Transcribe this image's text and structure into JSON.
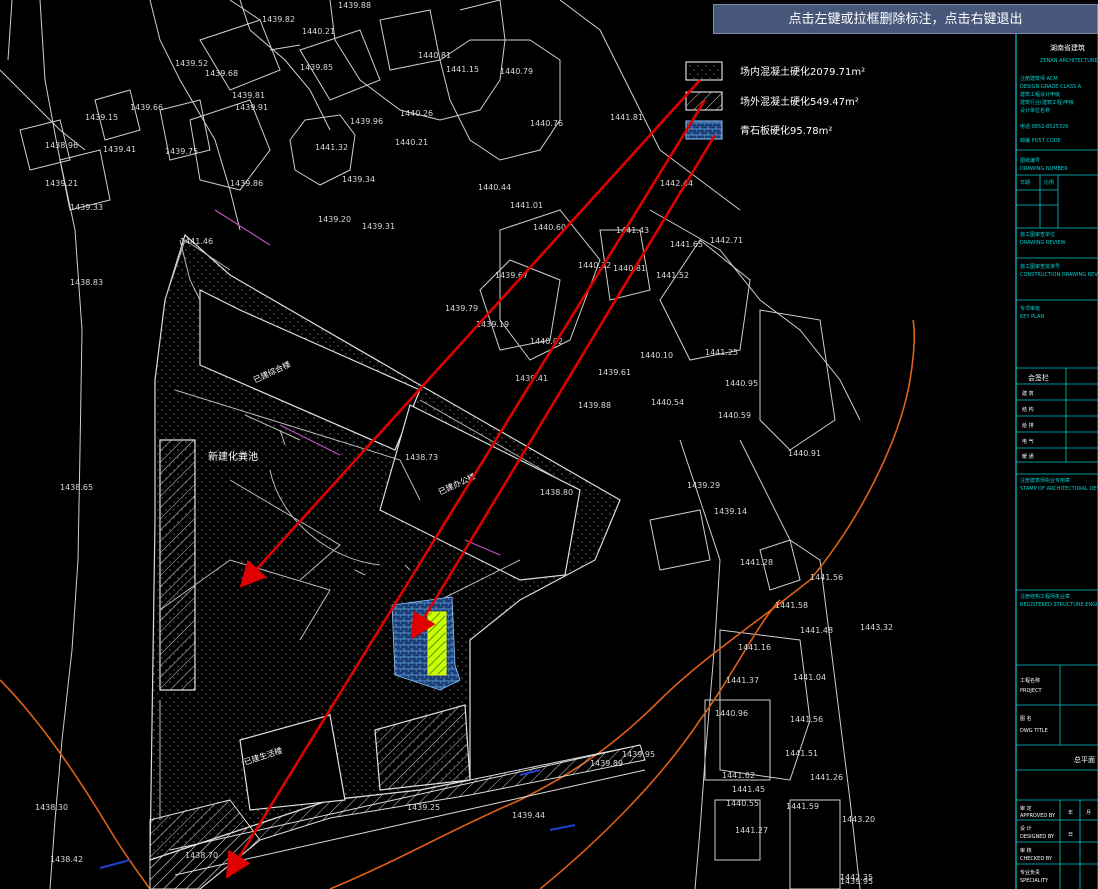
{
  "hint_bar": {
    "text": "点击左键或拉框删除标注，点击右键退出"
  },
  "legend": [
    {
      "pattern": "dots",
      "label": "场内混凝土硬化2079.71m²"
    },
    {
      "pattern": "hatch",
      "label": "场外混凝土硬化549.47m²"
    },
    {
      "pattern": "brick",
      "label": "青石板硬化95.78m²"
    }
  ],
  "plan_labels": {
    "new_green": "新建化粪池",
    "elev": [
      "1439.82",
      "1439.88",
      "1440.21",
      "1439.52",
      "1439.68",
      "1439.81",
      "1439.85",
      "1440.81",
      "1441.15",
      "1440.79",
      "1439.66",
      "1439.91",
      "1439.96",
      "1440.26",
      "1439.15",
      "1439.41",
      "1438.96",
      "1439.75",
      "1439.34",
      "1439.21",
      "1439.33",
      "1439.86",
      "1441.32",
      "1440.76",
      "1441.81",
      "1440.21",
      "1440.44",
      "1441.01",
      "1439.20",
      "1439.31",
      "1440.60",
      "1441.43",
      "1441.65",
      "1442.71",
      "1438.83",
      "1439.67",
      "1440.32",
      "1441.52",
      "1440.81",
      "1439.79",
      "1439.19",
      "1440.02",
      "1440.10",
      "1441.25",
      "1439.41",
      "1439.61",
      "1440.95",
      "1440.54",
      "1440.59",
      "1439.88",
      "1438.73",
      "1440.91",
      "1438.80",
      "1438.65",
      "1439.29",
      "1439.14",
      "1441.28",
      "1441.56",
      "1441.58",
      "1441.48",
      "1443.32",
      "1441.16",
      "1441.04",
      "1441.37",
      "1440.96",
      "1441.56",
      "1441.51",
      "1441.26",
      "1441.62",
      "1441.45",
      "1440.55",
      "1441.59",
      "1441.27",
      "1439.95",
      "1439.89",
      "1439.25",
      "1439.44",
      "1438.30",
      "1438.42",
      "1438.70",
      "1443.20",
      "1439.95",
      "1442.35",
      "1441.46",
      "1442.44"
    ],
    "bldg_a": "已建综合楼",
    "bldg_b": "已建办公楼",
    "bldg_c": "已建生活楼"
  },
  "title_block": {
    "firm": "湖南省建筑",
    "firm_en": "ZENAN ARCHITECTURE",
    "rows": [
      "工程名称",
      "PROJECT",
      "图 名",
      "DWG TITLE",
      "审 定",
      "APPROVED BY",
      "设 计",
      "DESIGNED BY",
      "审 核",
      "CHECKED BY",
      "专业负责",
      "SPECIALITY",
      "会签栏"
    ],
    "sign_rows": [
      "建 筑",
      "结 构",
      "给 排",
      "电 气",
      "暖 通"
    ],
    "cols": [
      "年",
      "月",
      "日"
    ],
    "project_code": "总平面"
  },
  "colors": {
    "arrow": "#e00000",
    "hint_bg": "#47577a",
    "contour": "#e0601a",
    "cyan": "#00c8d0",
    "hatch": "#cccccc",
    "brick": "#3a6fa8",
    "highlight": "#c8ff00"
  }
}
